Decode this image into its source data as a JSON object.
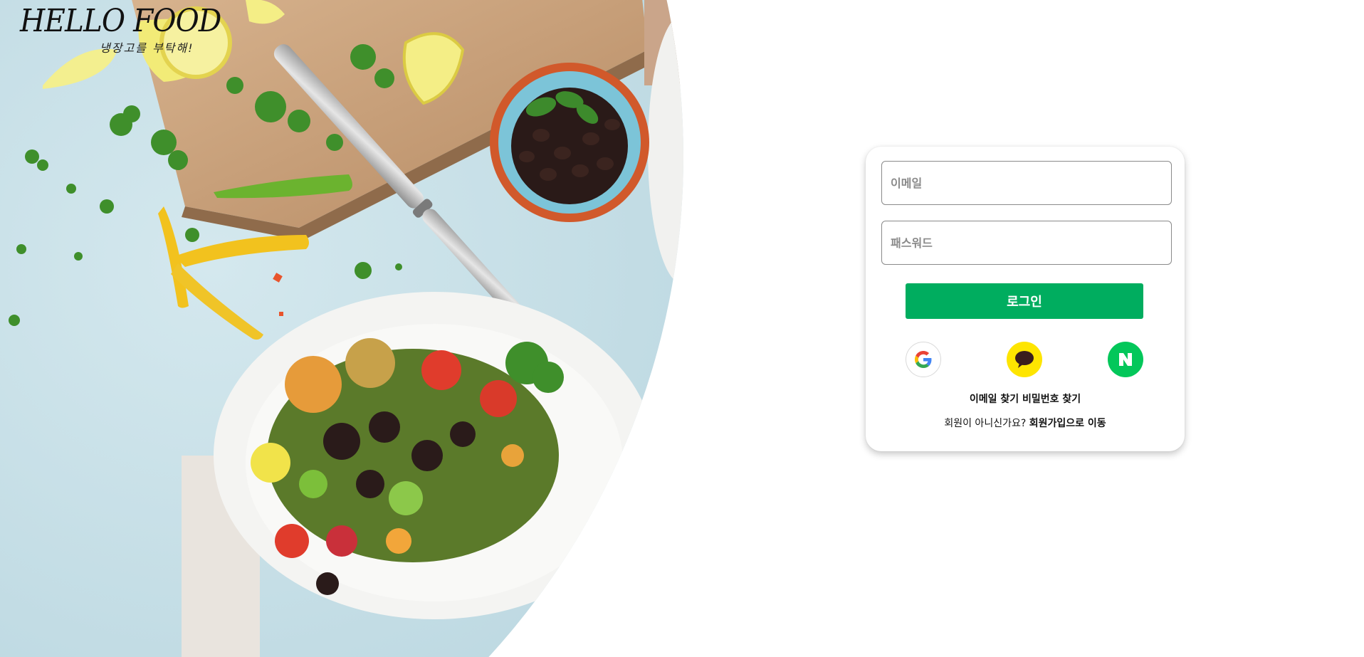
{
  "logo": {
    "title": "HELLO FOOD",
    "subtitle": "냉장고를 부탁해!"
  },
  "hero": {
    "description_icon": "food-photo"
  },
  "login": {
    "email_placeholder": "이메일",
    "password_placeholder": "패스워드",
    "login_label": "로그인",
    "social": [
      {
        "name": "google",
        "icon": "google-icon"
      },
      {
        "name": "kakao",
        "icon": "kakao-talk-icon"
      },
      {
        "name": "naver",
        "icon": "naver-icon",
        "glyph": "N"
      }
    ],
    "find_email": "이메일 찾기",
    "find_password": "비밀번호 찾기",
    "signup_prompt": "회원이 아니신가요?",
    "signup_link": "회원가입으로 이동"
  },
  "colors": {
    "primary_green": "#00ad5f",
    "kakao_yellow": "#fee500",
    "naver_green": "#03c75a",
    "hero_background": "#c9e1e8"
  }
}
